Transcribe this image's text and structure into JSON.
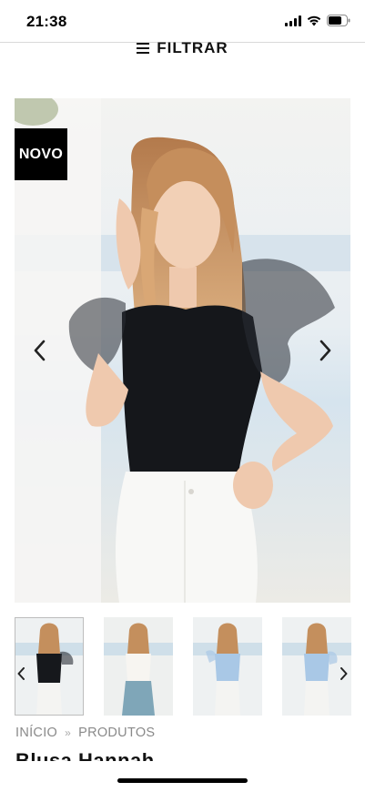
{
  "status_bar": {
    "time": "21:38",
    "icons": [
      "cellular-signal-icon",
      "wifi-icon",
      "battery-icon"
    ]
  },
  "filter": {
    "label": "FILTRAR",
    "icon": "hamburger-menu-icon"
  },
  "hero": {
    "badge": "NOVO",
    "prev_icon": "chevron-left-icon",
    "next_icon": "chevron-right-icon",
    "top_color": "#111418",
    "bottom_color": "#f6f6f4"
  },
  "thumbnails": {
    "items": [
      {
        "top_color": "#16181c",
        "bottom_color": "#f4f4f2",
        "selected": true
      },
      {
        "top_color": "#f7f5f1",
        "bottom_color": "#7fa6b8",
        "selected": false
      },
      {
        "top_color": "#a9c8e6",
        "bottom_color": "#f4f4f2",
        "selected": false
      },
      {
        "top_color": "#a9c8e6",
        "bottom_color": "#f4f4f2",
        "selected": false
      }
    ],
    "prev_icon": "chevron-left-icon",
    "next_icon": "chevron-right-icon"
  },
  "breadcrumb": {
    "items": [
      "INÍCIO",
      "PRODUTOS"
    ],
    "separator": "»"
  },
  "product": {
    "title": "Blusa Hannah"
  },
  "colors": {
    "accent": "#000000",
    "muted_text": "#8a8a8a"
  }
}
